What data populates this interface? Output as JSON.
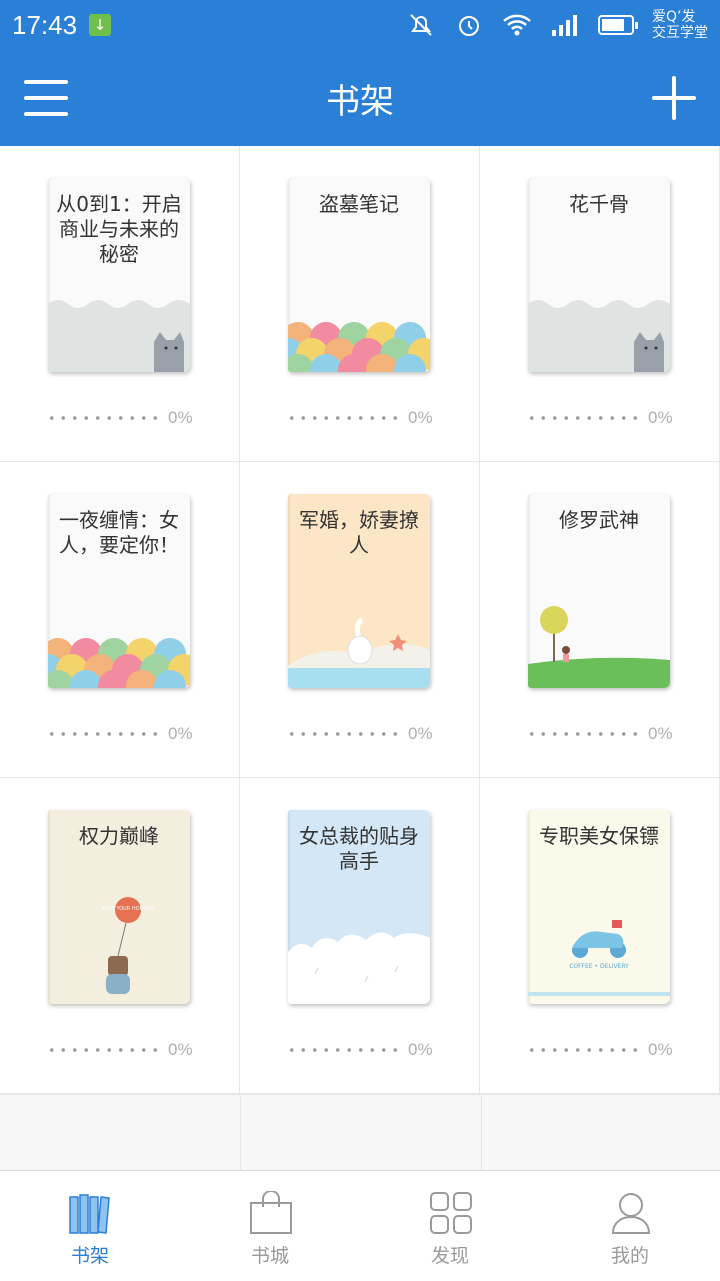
{
  "status_bar": {
    "time": "17:43",
    "watermark_line1": "爱Q’发",
    "watermark_line2": "交互学堂",
    "icons": [
      "download-icon",
      "mute-icon",
      "alarm-icon",
      "wifi-icon",
      "signal-icon",
      "battery-icon"
    ]
  },
  "app_bar": {
    "title": "书架",
    "menu_icon": "menu-icon",
    "add_icon": "plus-icon"
  },
  "books": [
    {
      "title": "从0到1：开启商业与未来的秘密",
      "progress": "0%",
      "cover": "cat"
    },
    {
      "title": "盗墓笔记",
      "progress": "0%",
      "cover": "scales"
    },
    {
      "title": "花千骨",
      "progress": "0%",
      "cover": "cat"
    },
    {
      "title": "一夜缠情：女人，要定你！",
      "progress": "0%",
      "cover": "scales"
    },
    {
      "title": "军婚，娇妻撩人",
      "progress": "0%",
      "cover": "goose"
    },
    {
      "title": "修罗武神",
      "progress": "0%",
      "cover": "tree"
    },
    {
      "title": "权力巅峰",
      "progress": "0%",
      "cover": "balloon"
    },
    {
      "title": "女总裁的贴身高手",
      "progress": "0%",
      "cover": "clouds"
    },
    {
      "title": "专职美女保镖",
      "progress": "0%",
      "cover": "scooter"
    }
  ],
  "cover_texts": {
    "balloon": "KEEP YOUR HOLIDAY",
    "scooter": "COFFEE • DELIVERY"
  },
  "bottom_nav": [
    {
      "label": "书架",
      "icon": "bookshelf-icon",
      "active": true
    },
    {
      "label": "书城",
      "icon": "shopping-bag-icon",
      "active": false
    },
    {
      "label": "发现",
      "icon": "grid-icon",
      "active": false
    },
    {
      "label": "我的",
      "icon": "user-icon",
      "active": false
    }
  ],
  "colors": {
    "primary": "#2a7fd6",
    "inactive": "#9a9a9a"
  }
}
